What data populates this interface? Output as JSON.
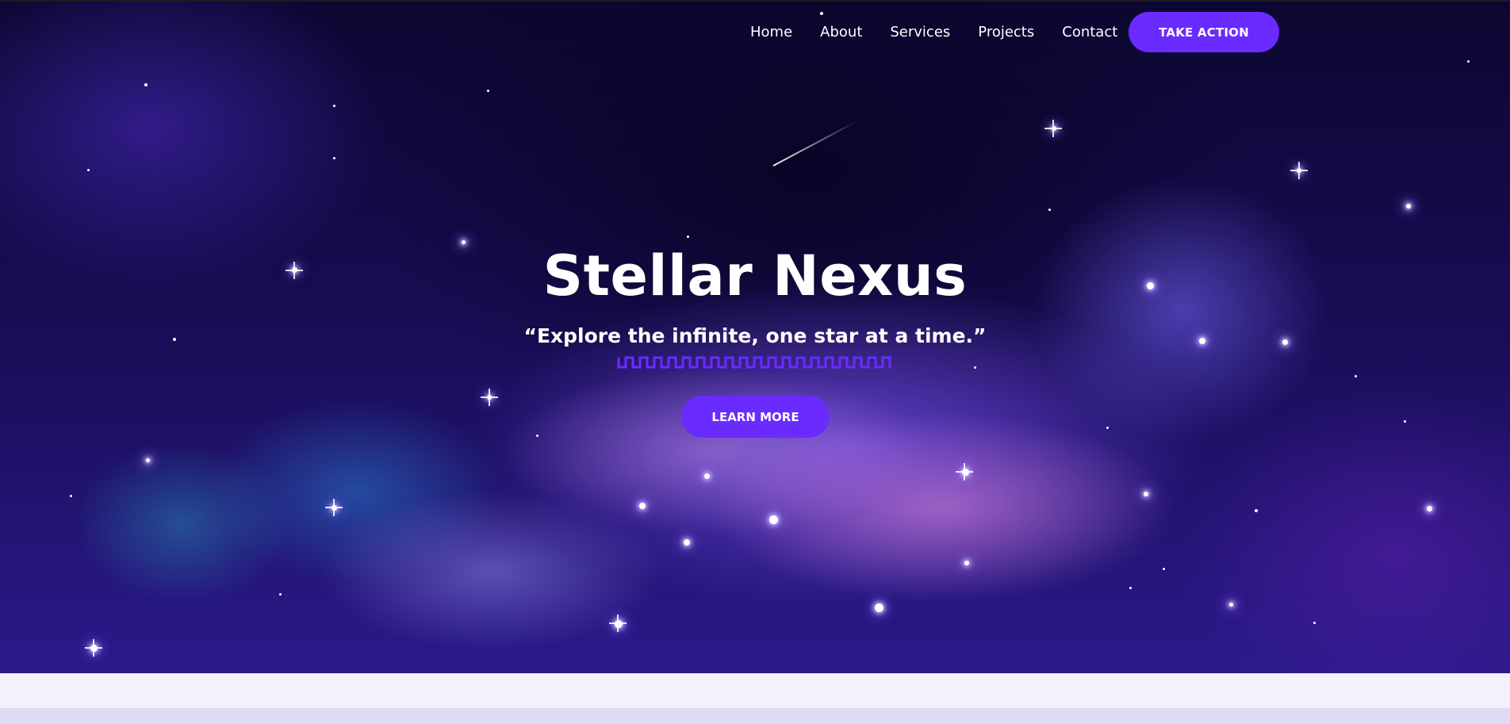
{
  "nav": {
    "links": [
      {
        "label": "Home"
      },
      {
        "label": "About"
      },
      {
        "label": "Services"
      },
      {
        "label": "Projects"
      },
      {
        "label": "Contact"
      }
    ],
    "cta_label": "TAKE ACTION"
  },
  "hero": {
    "title": "Stellar Nexus",
    "tagline": "“Explore the infinite, one star at a time.”",
    "button_label": "LEARN MORE"
  },
  "colors": {
    "accent": "#6a2bff",
    "text": "#ffffff",
    "page_background": "#f3f1fc",
    "lower_band": "#dddbf5"
  },
  "icons": {
    "tagline_underline": "zigzag-underline"
  }
}
